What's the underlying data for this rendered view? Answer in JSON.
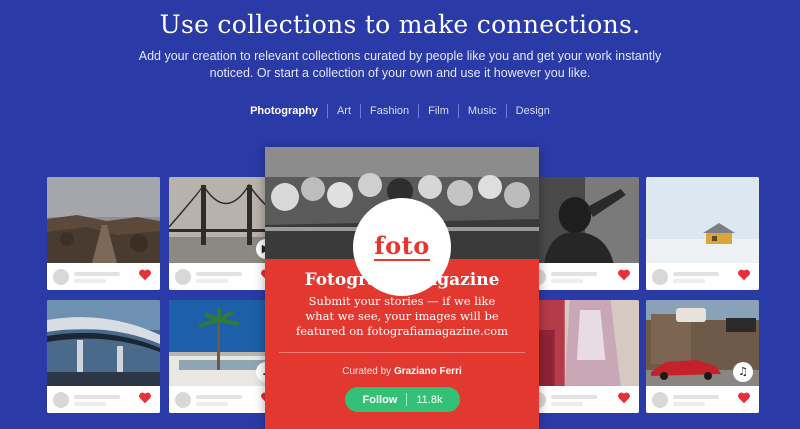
{
  "hero": {
    "title": "Use collections to make connections.",
    "description": "Add your creation to relevant collections curated by people like you and get your work instantly noticed. Or start a collection of your own and use it however you like."
  },
  "tabs": [
    {
      "label": "Photography",
      "active": true
    },
    {
      "label": "Art",
      "active": false
    },
    {
      "label": "Fashion",
      "active": false
    },
    {
      "label": "Film",
      "active": false
    },
    {
      "label": "Music",
      "active": false
    },
    {
      "label": "Design",
      "active": false
    }
  ],
  "featured": {
    "logo_text": "foto",
    "title": "Fotografia Magazine",
    "description": "Submit your stories — if we like what we see, your images will be featured on fotografiamagazine.com",
    "curated_prefix": "Curated by",
    "curator": "Graziano Ferri",
    "follow_label": "Follow",
    "followers": "11.8k"
  },
  "cards": [
    {
      "name": "rocky-landscape",
      "media": null
    },
    {
      "name": "golden-gate-bridge",
      "media": "video-icon"
    },
    {
      "name": "boy-portrait",
      "media": null
    },
    {
      "name": "snow-house",
      "media": null
    },
    {
      "name": "highway-overpass",
      "media": null
    },
    {
      "name": "palm-tree-building",
      "media": "music-icon"
    },
    {
      "name": "fashion-dress",
      "media": null
    },
    {
      "name": "red-car-pepsi",
      "media": "music-icon"
    }
  ],
  "colors": {
    "background": "#2a3ba8",
    "featured_red": "#e3382f",
    "follow_green": "#33c275",
    "heart_red": "#e8303a"
  }
}
